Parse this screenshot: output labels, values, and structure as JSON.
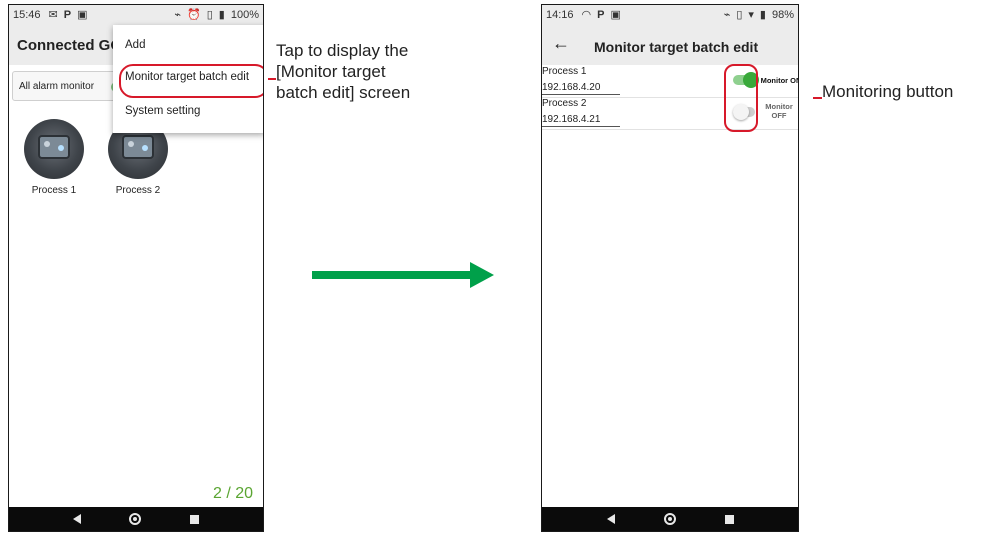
{
  "phone1": {
    "status": {
      "time": "15:46",
      "battery": "100%"
    },
    "title": "Connected GOT",
    "all_alarm_label": "All alarm monitor",
    "menu": {
      "items": [
        "Add",
        "Monitor target batch edit",
        "System setting"
      ]
    },
    "tiles": [
      {
        "label": "Process 1"
      },
      {
        "label": "Process 2"
      }
    ],
    "pager": "2 / 20"
  },
  "phone2": {
    "status": {
      "time": "14:16",
      "battery": "98%"
    },
    "title": "Monitor target batch edit",
    "rows": [
      {
        "name": "Process 1",
        "ip": "192.168.4.20",
        "switch_label": "Monitor ON",
        "on": true
      },
      {
        "name": "Process 2",
        "ip": "192.168.4.21",
        "switch_label_line1": "Monitor",
        "switch_label_line2": "OFF",
        "on": false
      }
    ]
  },
  "annotations": {
    "menu_callout": [
      "Tap to display the",
      "[Monitor target",
      "batch edit] screen"
    ],
    "switch_callout": "Monitoring button"
  },
  "colors": {
    "highlight": "#d7192a",
    "arrow": "#00a04a",
    "switch_on": "#39a93a",
    "pager": "#5aa532"
  },
  "icons": {
    "status_left": [
      "message-icon",
      "parking-icon",
      "screenshot-icon"
    ],
    "status_right": [
      "cast-icon",
      "alarm-icon",
      "vibrate-icon",
      "battery-icon"
    ],
    "nav": [
      "back-icon",
      "home-icon",
      "recent-apps-icon"
    ]
  }
}
